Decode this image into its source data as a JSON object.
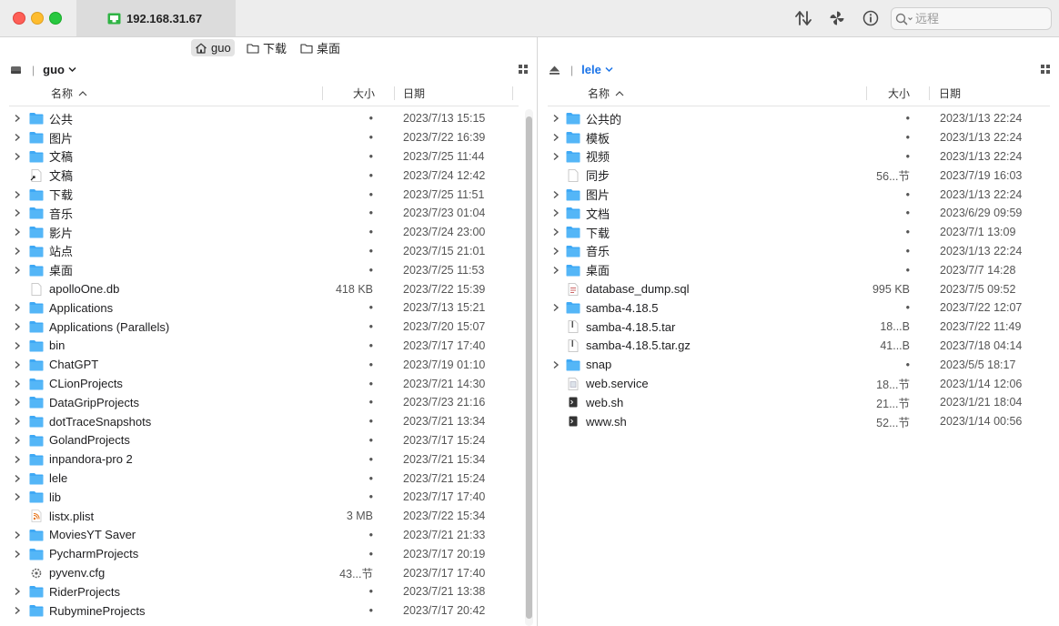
{
  "window": {
    "tab_title": "192.168.31.67",
    "search_placeholder": "远程"
  },
  "favorites": [
    {
      "label": "guo",
      "icon": "home-icon"
    },
    {
      "label": "下载",
      "icon": "folder-icon"
    },
    {
      "label": "桌面",
      "icon": "folder-icon"
    }
  ],
  "left": {
    "path_name": "guo",
    "columns": {
      "name": "名称",
      "size": "大小",
      "date": "日期"
    },
    "rows": [
      {
        "name": "公共",
        "size": "•",
        "date": "2023/7/13 15:15",
        "type": "folder"
      },
      {
        "name": "图片",
        "size": "•",
        "date": "2023/7/22 16:39",
        "type": "folder"
      },
      {
        "name": "文稿",
        "size": "•",
        "date": "2023/7/25 11:44",
        "type": "folder"
      },
      {
        "name": "文稿",
        "size": "•",
        "date": "2023/7/24 12:42",
        "type": "alias"
      },
      {
        "name": "下载",
        "size": "•",
        "date": "2023/7/25 11:51",
        "type": "folder"
      },
      {
        "name": "音乐",
        "size": "•",
        "date": "2023/7/23 01:04",
        "type": "folder"
      },
      {
        "name": "影片",
        "size": "•",
        "date": "2023/7/24 23:00",
        "type": "folder"
      },
      {
        "name": "站点",
        "size": "•",
        "date": "2023/7/15 21:01",
        "type": "folder"
      },
      {
        "name": "桌面",
        "size": "•",
        "date": "2023/7/25 11:53",
        "type": "folder"
      },
      {
        "name": "apolloOne.db",
        "size": "418 KB",
        "date": "2023/7/22 15:39",
        "type": "file"
      },
      {
        "name": "Applications",
        "size": "•",
        "date": "2023/7/13 15:21",
        "type": "folder"
      },
      {
        "name": "Applications (Parallels)",
        "size": "•",
        "date": "2023/7/20 15:07",
        "type": "folder"
      },
      {
        "name": "bin",
        "size": "•",
        "date": "2023/7/17 17:40",
        "type": "folder"
      },
      {
        "name": "ChatGPT",
        "size": "•",
        "date": "2023/7/19 01:10",
        "type": "folder"
      },
      {
        "name": "CLionProjects",
        "size": "•",
        "date": "2023/7/21 14:30",
        "type": "folder"
      },
      {
        "name": "DataGripProjects",
        "size": "•",
        "date": "2023/7/23 21:16",
        "type": "folder"
      },
      {
        "name": "dotTraceSnapshots",
        "size": "•",
        "date": "2023/7/21 13:34",
        "type": "folder"
      },
      {
        "name": "GolandProjects",
        "size": "•",
        "date": "2023/7/17 15:24",
        "type": "folder"
      },
      {
        "name": "inpandora-pro 2",
        "size": "•",
        "date": "2023/7/21 15:34",
        "type": "folder"
      },
      {
        "name": "lele",
        "size": "•",
        "date": "2023/7/21 15:24",
        "type": "folder"
      },
      {
        "name": "lib",
        "size": "•",
        "date": "2023/7/17 17:40",
        "type": "folder"
      },
      {
        "name": "listx.plist",
        "size": "3 MB",
        "date": "2023/7/22 15:34",
        "type": "plist"
      },
      {
        "name": "MoviesYT Saver",
        "size": "•",
        "date": "2023/7/21 21:33",
        "type": "folder"
      },
      {
        "name": "PycharmProjects",
        "size": "•",
        "date": "2023/7/17 20:19",
        "type": "folder"
      },
      {
        "name": "pyvenv.cfg",
        "size": "43...节",
        "date": "2023/7/17 17:40",
        "type": "cfg"
      },
      {
        "name": "RiderProjects",
        "size": "•",
        "date": "2023/7/21 13:38",
        "type": "folder"
      },
      {
        "name": "RubymineProjects",
        "size": "•",
        "date": "2023/7/17 20:42",
        "type": "folder"
      }
    ]
  },
  "right": {
    "path_name": "lele",
    "columns": {
      "name": "名称",
      "size": "大小",
      "date": "日期"
    },
    "rows": [
      {
        "name": "公共的",
        "size": "•",
        "date": "2023/1/13 22:24",
        "type": "folder"
      },
      {
        "name": "模板",
        "size": "•",
        "date": "2023/1/13 22:24",
        "type": "folder"
      },
      {
        "name": "视频",
        "size": "•",
        "date": "2023/1/13 22:24",
        "type": "folder"
      },
      {
        "name": "同步",
        "size": "56...节",
        "date": "2023/7/19 16:03",
        "type": "file"
      },
      {
        "name": "图片",
        "size": "•",
        "date": "2023/1/13 22:24",
        "type": "folder"
      },
      {
        "name": "文档",
        "size": "•",
        "date": "2023/6/29 09:59",
        "type": "folder"
      },
      {
        "name": "下载",
        "size": "•",
        "date": "2023/7/1 13:09",
        "type": "folder"
      },
      {
        "name": "音乐",
        "size": "•",
        "date": "2023/1/13 22:24",
        "type": "folder"
      },
      {
        "name": "桌面",
        "size": "•",
        "date": "2023/7/7 14:28",
        "type": "folder"
      },
      {
        "name": "database_dump.sql",
        "size": "995 KB",
        "date": "2023/7/5 09:52",
        "type": "sql"
      },
      {
        "name": "samba-4.18.5",
        "size": "•",
        "date": "2023/7/22 12:07",
        "type": "folder"
      },
      {
        "name": "samba-4.18.5.tar",
        "size": "18...B",
        "date": "2023/7/22 11:49",
        "type": "archive"
      },
      {
        "name": "samba-4.18.5.tar.gz",
        "size": "41...B",
        "date": "2023/7/18 04:14",
        "type": "archive"
      },
      {
        "name": "snap",
        "size": "•",
        "date": "2023/5/5 18:17",
        "type": "folder"
      },
      {
        "name": "web.service",
        "size": "18...节",
        "date": "2023/1/14 12:06",
        "type": "service"
      },
      {
        "name": "web.sh",
        "size": "21...节",
        "date": "2023/1/21 18:04",
        "type": "shell"
      },
      {
        "name": "www.sh",
        "size": "52...节",
        "date": "2023/1/14 00:56",
        "type": "shell"
      }
    ]
  },
  "colors": {
    "folder": "#3fa9f5",
    "accent": "#1a73e8"
  }
}
